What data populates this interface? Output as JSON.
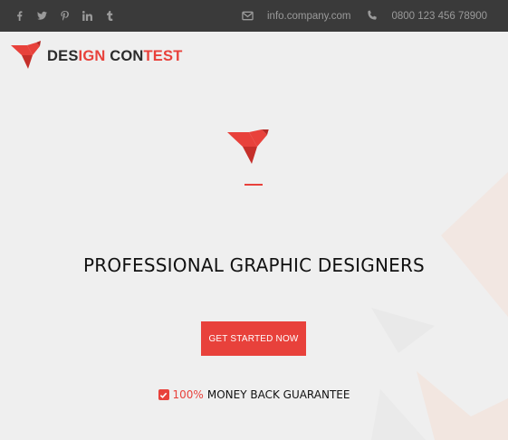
{
  "topbar": {
    "social": [
      {
        "icon": "facebook-icon",
        "glyph": "f"
      },
      {
        "icon": "twitter-icon",
        "glyph": ""
      },
      {
        "icon": "pinterest-icon",
        "glyph": ""
      },
      {
        "icon": "linkedin-icon",
        "glyph": "in"
      },
      {
        "icon": "tumblr-icon",
        "glyph": "t"
      }
    ],
    "email": "info.company.com",
    "phone": "0800 123 456 78900"
  },
  "logo": {
    "part1": "DES",
    "part2": "IGN",
    "part3": " CON",
    "part4": "TEST"
  },
  "hero": {
    "headline": "PROFESSIONAL GRAPHIC DESIGNERS",
    "cta_label": "GET STARTED NOW",
    "guarantee_highlight": "100%",
    "guarantee_text": "MONEY BACK GUARANTEE"
  },
  "colors": {
    "accent": "#e8413b",
    "topbar_bg": "#3a3a3a",
    "page_bg": "#efefef"
  }
}
